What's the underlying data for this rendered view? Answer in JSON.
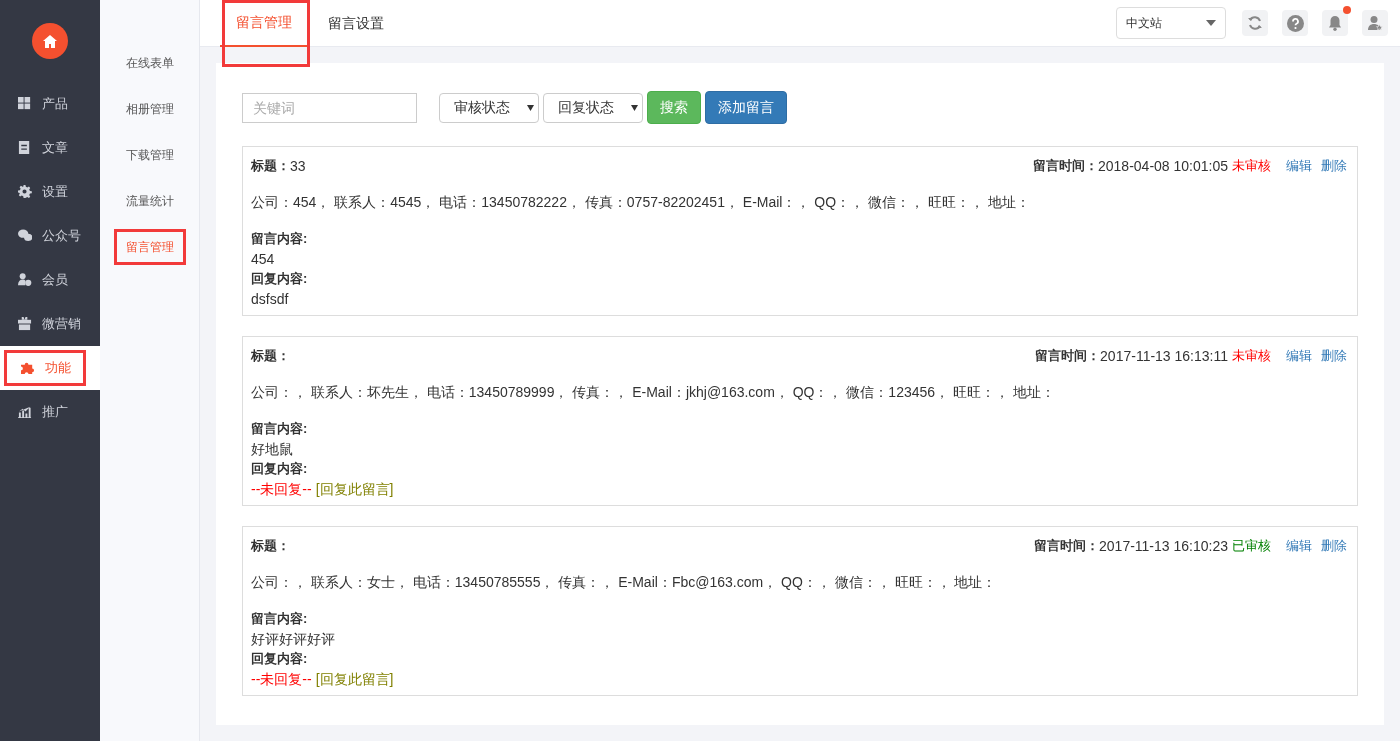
{
  "sidebar": {
    "items": [
      {
        "label": "产品",
        "selected": false,
        "annotated": false
      },
      {
        "label": "文章",
        "selected": false,
        "annotated": false
      },
      {
        "label": "设置",
        "selected": false,
        "annotated": false
      },
      {
        "label": "公众号",
        "selected": false,
        "annotated": false
      },
      {
        "label": "会员",
        "selected": false,
        "annotated": false
      },
      {
        "label": "微营销",
        "selected": false,
        "annotated": false
      },
      {
        "label": "功能",
        "selected": true,
        "annotated": true
      },
      {
        "label": "推广",
        "selected": false,
        "annotated": false
      }
    ]
  },
  "subnav": {
    "items": [
      {
        "label": "在线表单",
        "selected": false,
        "annotated": false
      },
      {
        "label": "相册管理",
        "selected": false,
        "annotated": false
      },
      {
        "label": "下载管理",
        "selected": false,
        "annotated": false
      },
      {
        "label": "流量统计",
        "selected": false,
        "annotated": false
      },
      {
        "label": "留言管理",
        "selected": true,
        "annotated": true
      }
    ]
  },
  "tabs": [
    {
      "label": "留言管理",
      "selected": true,
      "annotated": true
    },
    {
      "label": "留言设置",
      "selected": false,
      "annotated": false
    }
  ],
  "topbar": {
    "site": "中文站",
    "notification": true
  },
  "filters": {
    "keyword_placeholder": "关键词",
    "review_select": "审核状态",
    "reply_select": "回复状态",
    "search_button": "搜索",
    "add_button": "添加留言"
  },
  "messages": [
    {
      "title_label": "标题：",
      "title": "33",
      "time_label": "留言时间：",
      "time": "2018-04-08 10:01:05",
      "status": "未审核",
      "reviewed": false,
      "edit": "编辑",
      "delete": "删除",
      "info": "公司：454， 联系人：4545， 电话：13450782222， 传真：0757-82202451， E-Mail：， QQ：， 微信：， 旺旺：， 地址：",
      "content_label": "留言内容:",
      "content": "454",
      "reply_label": "回复内容:",
      "kind": "replied",
      "reply": "dsfsdf"
    },
    {
      "title_label": "标题：",
      "time_label": "留言时间：",
      "time": "2017-11-13 16:13:11",
      "status": "未审核",
      "reviewed": false,
      "edit": "编辑",
      "delete": "删除",
      "info": "公司：， 联系人：坏先生， 电话：13450789999， 传真：， E-Mail：jkhj@163.com， QQ：， 微信：123456， 旺旺：， 地址：",
      "content_label": "留言内容:",
      "content": "好地鼠",
      "reply_label": "回复内容:",
      "kind": "unreplied",
      "no_reply": "--未回复--",
      "reply_link": "[回复此留言]"
    },
    {
      "title_label": "标题：",
      "time_label": "留言时间：",
      "time": "2017-11-13 16:10:23",
      "status": "已审核",
      "reviewed": true,
      "edit": "编辑",
      "delete": "删除",
      "info": "公司：， 联系人：女士， 电话：13450785555， 传真：， E-Mail：Fbc@163.com， QQ：， 微信：， 旺旺：， 地址：",
      "content_label": "留言内容:",
      "content": "好评好评好评",
      "reply_label": "回复内容:",
      "kind": "unreplied",
      "no_reply": "--未回复--",
      "reply_link": "[回复此留言]"
    }
  ]
}
